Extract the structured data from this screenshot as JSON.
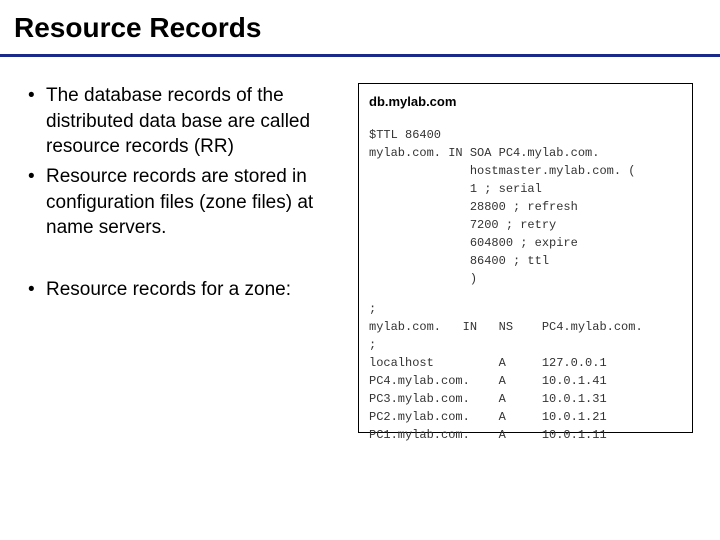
{
  "title": "Resource Records",
  "bullets": {
    "b1": "The database records of the distributed data base are called resource records (RR)",
    "b2": "Resource records are stored in configuration files (zone files) at name servers.",
    "b3": "Resource records for a zone:"
  },
  "zonefile": {
    "filename": "db.mylab.com",
    "l1": "$TTL 86400",
    "l2": "mylab.com. IN SOA PC4.mylab.com.",
    "l3": "              hostmaster.mylab.com. (",
    "l4": "              1 ; serial",
    "l5": "              28800 ; refresh",
    "l6": "              7200 ; retry",
    "l7": "              604800 ; expire",
    "l8": "              86400 ; ttl",
    "l9": "              )",
    "l10": ";",
    "l11": "mylab.com.   IN   NS    PC4.mylab.com.",
    "l12": ";",
    "l13": "localhost         A     127.0.0.1",
    "l14": "PC4.mylab.com.    A     10.0.1.41",
    "l15": "PC3.mylab.com.    A     10.0.1.31",
    "l16": "PC2.mylab.com.    A     10.0.1.21",
    "l17": "PC1.mylab.com.    A     10.0.1.11"
  }
}
